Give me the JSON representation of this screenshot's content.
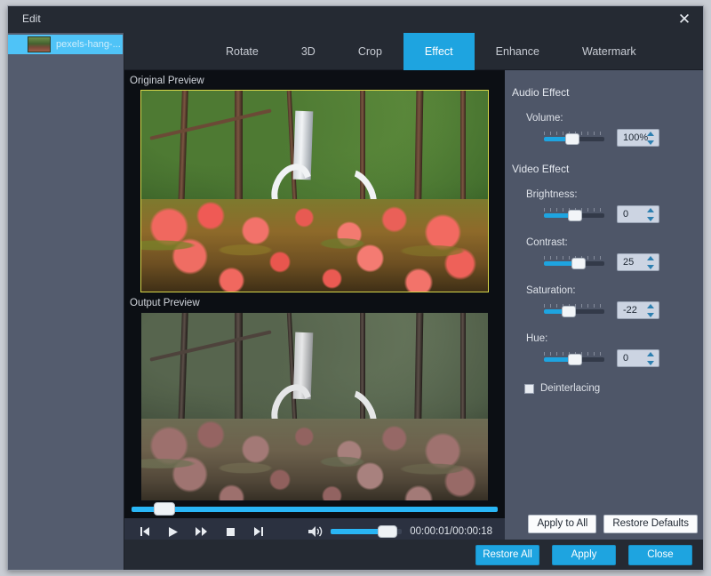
{
  "window": {
    "title": "Edit",
    "close_label": "✕"
  },
  "sidebar": {
    "items": [
      {
        "label": "pexels-hang-...",
        "selected": true
      }
    ]
  },
  "tabs": [
    {
      "label": "Rotate",
      "active": false
    },
    {
      "label": "3D",
      "active": false
    },
    {
      "label": "Crop",
      "active": false
    },
    {
      "label": "Effect",
      "active": true
    },
    {
      "label": "Enhance",
      "active": false
    },
    {
      "label": "Watermark",
      "active": false
    }
  ],
  "preview": {
    "original_label": "Original Preview",
    "output_label": "Output Preview"
  },
  "player": {
    "timecode": "00:00:01/00:00:18",
    "buttons": [
      {
        "name": "previous-button",
        "glyph": "⏮"
      },
      {
        "name": "play-button",
        "glyph": "▶"
      },
      {
        "name": "fast-forward-button",
        "glyph": "⏩"
      },
      {
        "name": "stop-button",
        "glyph": "■"
      },
      {
        "name": "next-button",
        "glyph": "⏭"
      }
    ],
    "volume_icon": "🔊",
    "seek_position_pct": 6,
    "volume_pct": 74
  },
  "panel": {
    "audio_group": "Audio Effect",
    "video_group": "Video Effect",
    "controls": [
      {
        "label": "Volume:",
        "value": "100%",
        "fill_pct": 40,
        "knob_pct": 36
      },
      {
        "label": "Brightness:",
        "value": "0",
        "fill_pct": 46,
        "knob_pct": 40
      },
      {
        "label": "Contrast:",
        "value": "25",
        "fill_pct": 52,
        "knob_pct": 46
      },
      {
        "label": "Saturation:",
        "value": "-22",
        "fill_pct": 34,
        "knob_pct": 30
      },
      {
        "label": "Hue:",
        "value": "0",
        "fill_pct": 46,
        "knob_pct": 40
      }
    ],
    "deinterlacing_label": "Deinterlacing",
    "deinterlacing_checked": false
  },
  "actions": {
    "apply_to_all": "Apply to All",
    "restore_defaults": "Restore Defaults",
    "restore_all": "Restore All",
    "apply": "Apply",
    "close": "Close"
  },
  "colors": {
    "accent": "#1ea4e0",
    "panel_bg": "#4e5668",
    "window_bg": "#252a33",
    "sidebar_selected": "#4fc3f7",
    "original_border": "#d8d84a"
  }
}
